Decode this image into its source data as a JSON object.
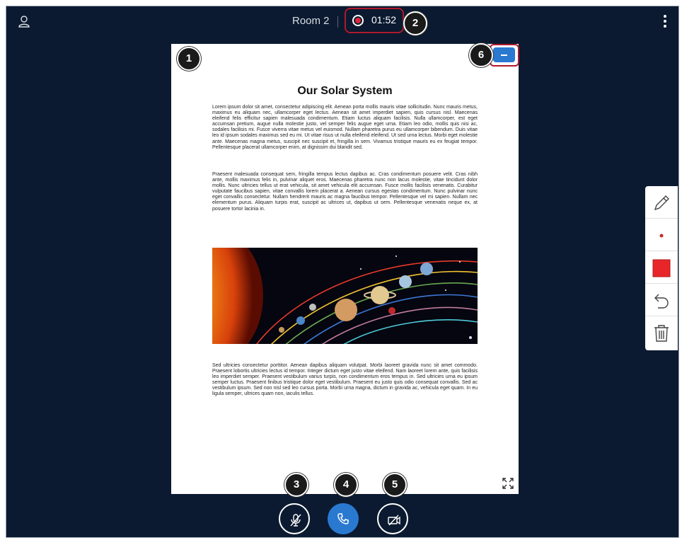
{
  "header": {
    "room_name": "Room 2",
    "recording_time": "01:52"
  },
  "document": {
    "title": "Our Solar System",
    "paragraph1": "Lorem ipsum dolor sit amet, consectetur adipiscing elit. Aenean porta mollis mauris vitae sollicitudin. Nunc mauris metus, maximus eu aliquam nec, ullamcorper eget lectus. Aenean sit amet imperdiet sapien, quis cursus nisl. Maecenas eleifend felis efficitur sapien malesuada condimentum. Etiam luctus aliquam facilisis. Nulla ullamcorper, est eget accumsan pretium, augue nulla molestie justo, vel semper felis augue eget urna. Etiam leo odio, mollis quis nisi ac, sodales facilisis mi. Fusce viverra vitae metus vel euismod. Nullam pharetra purus eu ullamcorper bibendum. Duis vitae leo id ipsum sodales maximus sed eu mi. Ut vitae risus ut nulla eleifend eleifend. Ut sed urna lectus. Morbi eget molestie ante. Maecenas magna metus, suscipit nec suscipit et, fringilla in sem. Vivamus tristique mauris eu ex feugiat tempor. Pellentesque placerat ullamcorper enim, at dignissim dui blandit sed.",
    "paragraph2": "Praesent malesuada consequat sem, fringilla tempus lectus dapibus ac. Cras condimentum posuere velit. Cras nibh ante, mollis maximus felis in, pulvinar aliquet eros. Maecenas pharetra nunc non lacus molestie, vitae tincidunt dolor mollis. Nunc ultricies tellus ut erat vehicula, sit amet vehicula elit accumsan. Fusce mollis facilisis venenatis. Curabitur vulputate faucibus sapien, vitae convallis lorem placerat a. Aenean cursus egestas condimentum. Nunc pulvinar nunc eget convallis consectetur. Nullam hendrerit mauris ac magna faucibus tempor. Pellentesque vel mi sapien. Nullam nec elementum purus. Aliquam turpis erat, suscipit ac ultrices ut, dapibus ut sem. Pellentesque venenatis neque ex, at posuere tortor lacinia in.",
    "paragraph3": "Sed ultricies consectetur porttitor. Aenean dapibus aliquam volutpat. Morbi laoreet gravida nunc sit amet commodo. Praesent lobortis ultricies lectus id tempor. Integer dictum eget justo vitae eleifend. Nam laoreet lorem ante, quis facilisis leo imperdiet semper. Praesent vestibulum varius turpis, non condimentum eros tempus in. Sed ultricies urna eu ipsum semper luctus. Praesent finibus tristique dolor eget vestibulum. Praesent eu justo quis odio consequat convallis. Sed ac vestibulum ipsum. Sed non nisl sed leo cursus porta. Morbi urna magna, dictum in gravida ac, vehicula eget quam. In eu ligula semper, ultrices quam non, iaculis tellus."
  },
  "callouts": [
    "1",
    "2",
    "3",
    "4",
    "5",
    "6"
  ],
  "toolbar": {
    "tools": [
      "pencil-icon",
      "dot-size-icon",
      "color-swatch",
      "undo-icon",
      "trash-icon"
    ],
    "selected_color": "#e8262a"
  },
  "colors": {
    "background": "#0b1a30",
    "accent": "#2a79d1",
    "highlight": "#b0192c",
    "record": "#e0243a"
  }
}
